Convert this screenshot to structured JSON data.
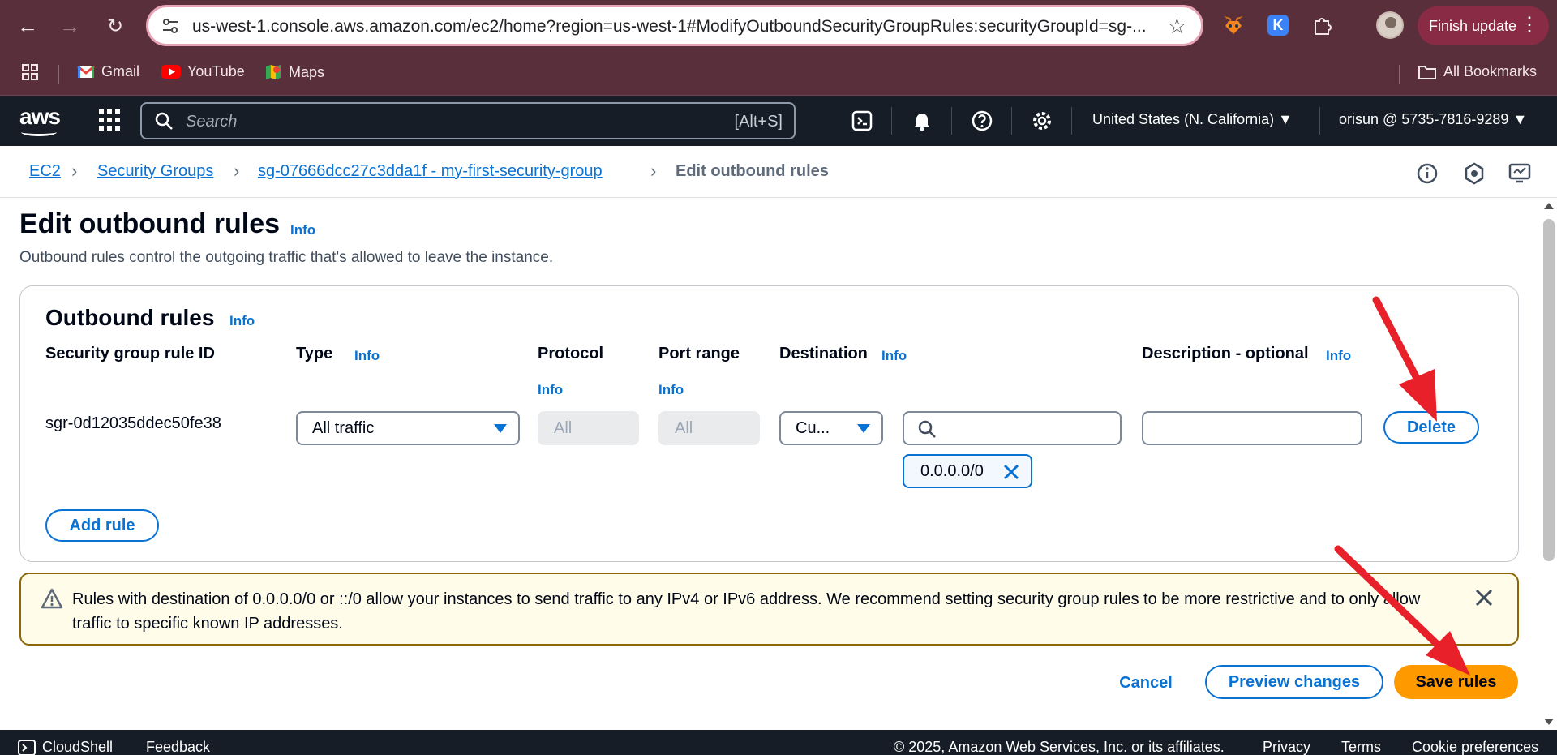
{
  "browser": {
    "url": "us-west-1.console.aws.amazon.com/ec2/home?region=us-west-1#ModifyOutboundSecurityGroupRules:securityGroupId=sg-...",
    "update_button": "Finish update",
    "bookmarks": [
      {
        "label": "Gmail",
        "icon": "gmail-icon"
      },
      {
        "label": "YouTube",
        "icon": "youtube-icon"
      },
      {
        "label": "Maps",
        "icon": "maps-icon"
      }
    ],
    "all_bookmarks": "All Bookmarks"
  },
  "aws_nav": {
    "logo": "aws",
    "search_placeholder": "Search",
    "search_shortcut": "[Alt+S]",
    "region": "United States (N. California)",
    "account": "orisun @ 5735-7816-9289"
  },
  "breadcrumbs": [
    {
      "label": "EC2"
    },
    {
      "label": "Security Groups"
    },
    {
      "label": "sg-07666dcc27c3dda1f - my-first-security-group"
    },
    {
      "label": "Edit outbound rules"
    }
  ],
  "page": {
    "title": "Edit outbound rules",
    "info": "Info",
    "description": "Outbound rules control the outgoing traffic that's allowed to leave the instance."
  },
  "outbound": {
    "title": "Outbound rules",
    "info": "Info",
    "columns": {
      "rule_id": "Security group rule ID",
      "type": "Type",
      "protocol": "Protocol",
      "port_range": "Port range",
      "destination": "Destination",
      "description": "Description - optional"
    },
    "rules": [
      {
        "id": "sgr-0d12035ddec50fe38",
        "type": "All traffic",
        "protocol": "All",
        "port_range": "All",
        "destination_type": "Cu...",
        "destination_search": "",
        "destination_token": "0.0.0.0/0",
        "description": "",
        "delete_label": "Delete"
      }
    ],
    "add_rule": "Add rule"
  },
  "alert": {
    "text": "Rules with destination of 0.0.0.0/0 or ::/0 allow your instances to send traffic to any IPv4 or IPv6 address. We recommend setting security group rules to be more restrictive and to only allow traffic to specific known IP addresses."
  },
  "actions": {
    "cancel": "Cancel",
    "preview": "Preview changes",
    "save": "Save rules"
  },
  "footer": {
    "cloudshell": "CloudShell",
    "feedback": "Feedback",
    "copyright": "© 2025, Amazon Web Services, Inc. or its affiliates.",
    "privacy": "Privacy",
    "terms": "Terms",
    "cookies": "Cookie preferences"
  },
  "colors": {
    "link": "#0972d3",
    "primary_button": "#ff9900",
    "alert_border": "#8d6605",
    "alert_bg": "#fffce9",
    "annotation_arrow": "#e8202a"
  }
}
